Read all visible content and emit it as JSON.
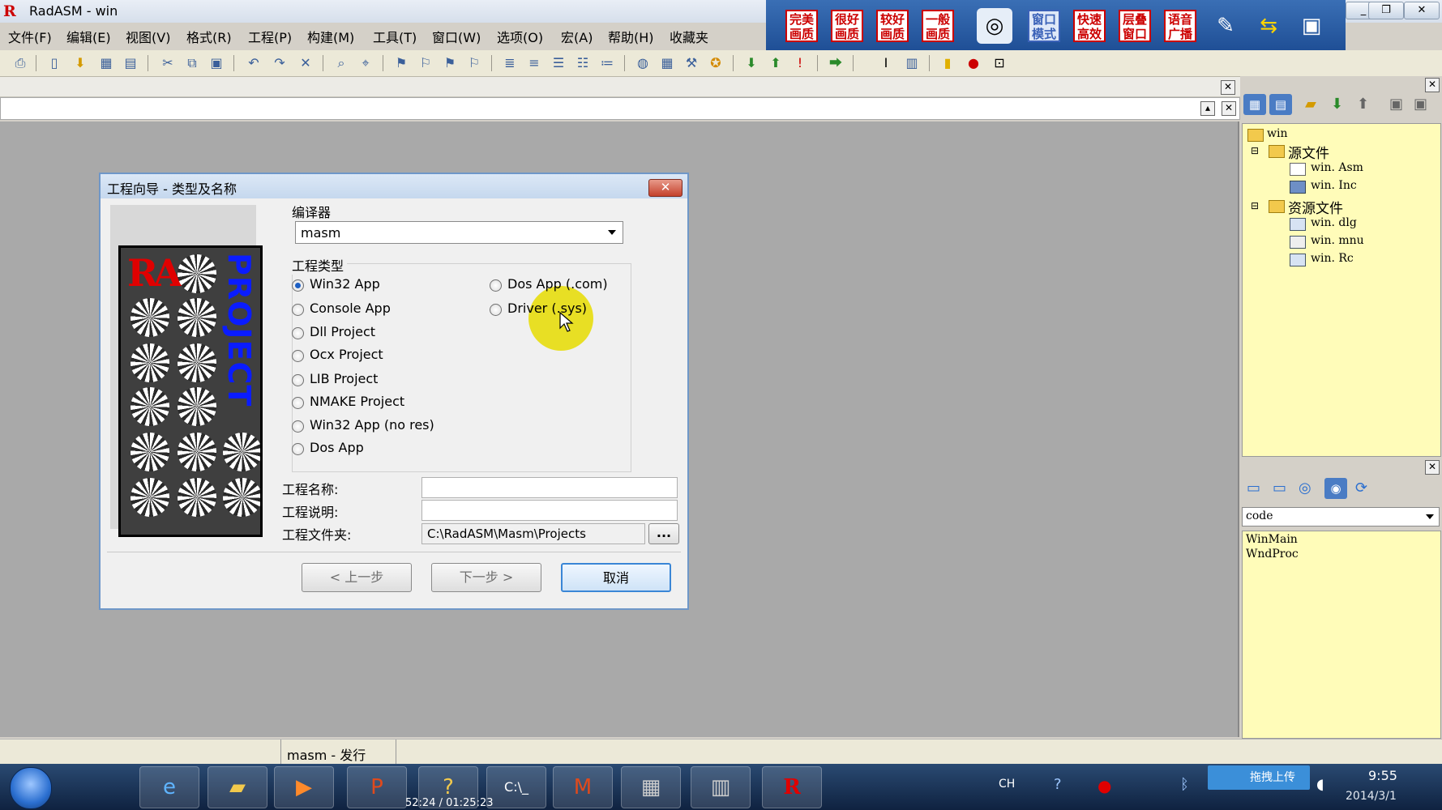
{
  "window": {
    "title": "RadASM - win"
  },
  "menu": [
    "文件(F)",
    "编辑(E)",
    "视图(V)",
    "格式(R)",
    "工程(P)",
    "构建(M)",
    "工具(T)",
    "窗口(W)",
    "选项(O)",
    "宏(A)",
    "帮助(H)",
    "收藏夹"
  ],
  "quality_buttons": [
    "完美画质",
    "很好画质",
    "较好画质",
    "一般画质",
    "窗口模式",
    "快速高效",
    "层叠窗口",
    "语音广播"
  ],
  "dialog": {
    "title": "工程向导 - 类型及名称",
    "compiler_label": "编译器",
    "compiler_value": "masm",
    "project_type_label": "工程类型",
    "image_text": "PROJECT",
    "project_types_left": [
      "Win32 App",
      "Console App",
      "Dll Project",
      "Ocx Project",
      "LIB Project",
      "NMAKE Project",
      "Win32 App (no res)",
      "Dos App"
    ],
    "project_types_right": [
      "Dos App (.com)",
      "Driver (.sys)"
    ],
    "selected_type": "Win32 App",
    "project_name_label": "工程名称:",
    "project_name_value": "",
    "project_desc_label": "工程说明:",
    "project_desc_value": "",
    "project_folder_label": "工程文件夹:",
    "project_folder_value": "C:\\RadASM\\Masm\\Projects",
    "browse_label": "...",
    "back_button": "< 上一步",
    "next_button": "下一步 >",
    "cancel_button": "取消"
  },
  "project_tree": {
    "root": "win",
    "groups": [
      {
        "name": "源文件",
        "files": [
          "win. Asm",
          "win. Inc"
        ]
      },
      {
        "name": "资源文件",
        "files": [
          "win. dlg",
          "win. mnu",
          "win. Rc"
        ]
      }
    ]
  },
  "properties": {
    "select_value": "code",
    "items": [
      "WinMain",
      "WndProc"
    ]
  },
  "statusbar": {
    "text": "masm - 发行"
  },
  "taskbar": {
    "video_time": "52:24 / 01:25:23",
    "upload_label": "拖拽上传",
    "lang": "CH",
    "clock_time": "9:55",
    "clock_date": "2014/3/1"
  },
  "colors": {
    "title_accent": "#6f97c8",
    "highlight": "#e6dc00",
    "tree_bg": "#fffcb9"
  }
}
